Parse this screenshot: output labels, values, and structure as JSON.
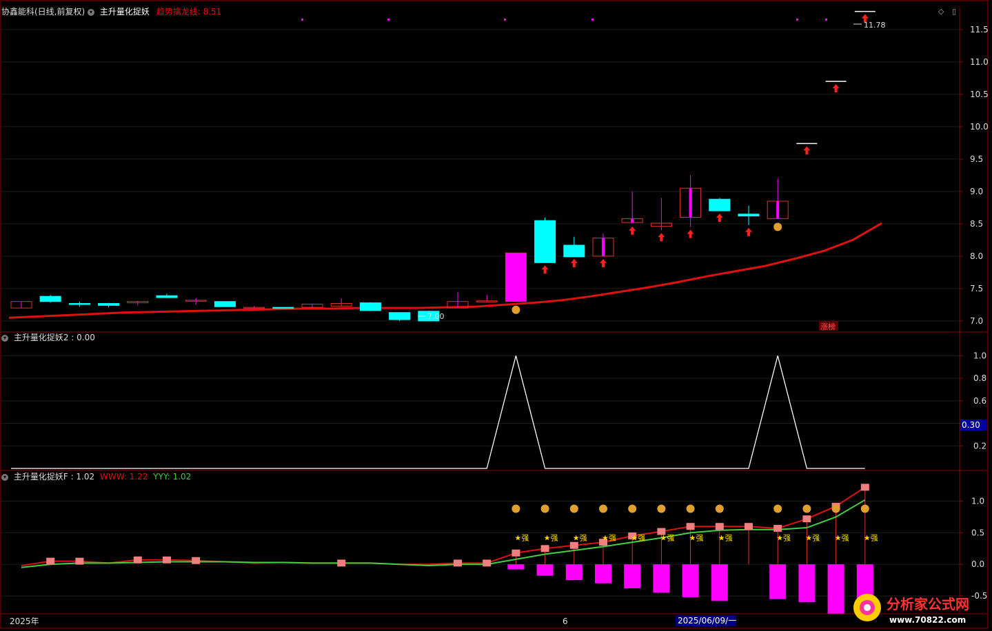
{
  "colors": {
    "background": "#000000",
    "up": "#ff00ff",
    "down": "#00ffff",
    "ma": "#e01010",
    "grid": "#1c1c1c",
    "axis_text": "#dddddd",
    "green_line": "#40d040",
    "salmon": "#f08080"
  },
  "panel1": {
    "stock_title": "协鑫能科(日线,前复权)",
    "indicator_name": "主升量化捉妖",
    "ma_label": "趋势擒龙线:",
    "ma_value": "8.51",
    "high_label": "11.78",
    "low_label": "7.00",
    "zt_badge": "涨榜",
    "axis_ticks": [
      "11.5",
      "11.0",
      "10.5",
      "10.0",
      "9.5",
      "9.0",
      "8.5",
      "8.0",
      "7.5",
      "7.0"
    ]
  },
  "panel2": {
    "title": "主升量化捉妖2",
    "value": "0.00",
    "axis_ticks": [
      "1.0",
      "0.8",
      "0.6",
      "0.4",
      "0.2"
    ],
    "cursor_value": "0.30"
  },
  "panel3": {
    "title": "主升量化捉妖F",
    "value": "1.02",
    "www_label": "WWW:",
    "www_value": "1.22",
    "yyy_label": "YYY:",
    "yyy_value": "1.02",
    "axis_ticks": [
      "1.0",
      "0.5",
      "0.0",
      "-0.5"
    ],
    "strong_label": "★强"
  },
  "date_axis": {
    "year_label": "2025年",
    "month_label": "6",
    "cursor_date": "2025/06/09/一"
  },
  "watermark": {
    "text": "分析家公式网",
    "url": "www.70822.com"
  },
  "chart_data": [
    {
      "type": "candlestick",
      "title": "协鑫能科(日线,前复权)",
      "ylim": [
        6.85,
        11.85
      ],
      "candles": [
        {
          "o": 7.2,
          "h": 7.3,
          "l": 7.2,
          "c": 7.3
        },
        {
          "o": 7.38,
          "h": 7.4,
          "l": 7.28,
          "c": 7.3
        },
        {
          "o": 7.27,
          "h": 7.3,
          "l": 7.22,
          "c": 7.26
        },
        {
          "o": 7.27,
          "h": 7.28,
          "l": 7.21,
          "c": 7.24
        },
        {
          "o": 7.28,
          "h": 7.31,
          "l": 7.24,
          "c": 7.3
        },
        {
          "o": 7.39,
          "h": 7.42,
          "l": 7.36,
          "c": 7.36
        },
        {
          "o": 7.32,
          "h": 7.35,
          "l": 7.25,
          "c": 7.32
        },
        {
          "o": 7.3,
          "h": 7.3,
          "l": 7.22,
          "c": 7.22
        },
        {
          "o": 7.21,
          "h": 7.23,
          "l": 7.2,
          "c": 7.21
        },
        {
          "o": 7.21,
          "h": 7.21,
          "l": 7.2,
          "c": 7.2
        },
        {
          "o": 7.21,
          "h": 7.26,
          "l": 7.2,
          "c": 7.26
        },
        {
          "o": 7.23,
          "h": 7.35,
          "l": 7.23,
          "c": 7.27
        },
        {
          "o": 7.28,
          "h": 7.29,
          "l": 7.15,
          "c": 7.16
        },
        {
          "o": 7.13,
          "h": 7.13,
          "l": 7.0,
          "c": 7.02
        },
        {
          "o": 7.15,
          "h": 7.16,
          "l": 7.0,
          "c": 7.0
        },
        {
          "o": 7.2,
          "h": 7.45,
          "l": 7.2,
          "c": 7.3
        },
        {
          "o": 7.31,
          "h": 7.4,
          "l": 7.3,
          "c": 7.31
        },
        {
          "o": 7.3,
          "h": 8.05,
          "l": 7.3,
          "c": 8.05
        },
        {
          "o": 8.55,
          "h": 8.6,
          "l": 7.9,
          "c": 7.9
        },
        {
          "o": 8.17,
          "h": 8.3,
          "l": 8.0,
          "c": 7.99
        },
        {
          "o": 8.0,
          "h": 8.35,
          "l": 8.0,
          "c": 8.28
        },
        {
          "o": 8.52,
          "h": 9.0,
          "l": 8.5,
          "c": 8.58
        },
        {
          "o": 8.46,
          "h": 8.9,
          "l": 8.4,
          "c": 8.51
        },
        {
          "o": 8.6,
          "h": 9.25,
          "l": 8.45,
          "c": 9.05
        },
        {
          "o": 8.88,
          "h": 8.9,
          "l": 8.7,
          "c": 8.7
        },
        {
          "o": 8.65,
          "h": 8.78,
          "l": 8.48,
          "c": 8.62
        },
        {
          "o": 8.58,
          "h": 9.2,
          "l": 8.58,
          "c": 8.85
        },
        {
          "o": 9.74,
          "h": 9.74,
          "l": 9.74,
          "c": 9.74
        },
        {
          "o": 10.7,
          "h": 10.7,
          "l": 10.7,
          "c": 10.7
        },
        {
          "o": 11.78,
          "h": 11.78,
          "l": 11.78,
          "c": 11.78
        }
      ],
      "ma_line": [
        7.05,
        7.07,
        7.09,
        7.11,
        7.13,
        7.14,
        7.15,
        7.16,
        7.17,
        7.18,
        7.19,
        7.19,
        7.2,
        7.2,
        7.2,
        7.21,
        7.22,
        7.25,
        7.28,
        7.32,
        7.38,
        7.45,
        7.52,
        7.6,
        7.69,
        7.77,
        7.85,
        7.96,
        8.08,
        8.25,
        8.51
      ]
    },
    {
      "type": "line",
      "title": "主升量化捉妖2",
      "ylim": [
        0,
        1.1
      ],
      "values": [
        0,
        0,
        0,
        0,
        0,
        0,
        0,
        0,
        0,
        0,
        0,
        0,
        0,
        0,
        0,
        0,
        0,
        1,
        0,
        0,
        0,
        0,
        0,
        0,
        0,
        0,
        1,
        0,
        0,
        0
      ]
    },
    {
      "type": "bar",
      "title": "主升量化捉妖F",
      "ylim": [
        -0.75,
        1.3
      ],
      "series": [
        {
          "name": "WWW",
          "values": [
            -0.02,
            0.05,
            0.05,
            0.02,
            0.07,
            0.07,
            0.06,
            0.04,
            0.02,
            0.03,
            0.02,
            0.02,
            0.02,
            0.0,
            0.0,
            0.02,
            0.02,
            0.18,
            0.25,
            0.3,
            0.35,
            0.45,
            0.52,
            0.6,
            0.6,
            0.6,
            0.57,
            0.72,
            0.92,
            1.22
          ]
        },
        {
          "name": "YYY",
          "values": [
            -0.05,
            0.0,
            0.02,
            0.02,
            0.03,
            0.04,
            0.04,
            0.04,
            0.03,
            0.03,
            0.02,
            0.02,
            0.02,
            0.0,
            -0.02,
            0.0,
            0.0,
            0.08,
            0.16,
            0.22,
            0.28,
            0.35,
            0.42,
            0.5,
            0.54,
            0.55,
            0.55,
            0.58,
            0.75,
            1.02
          ]
        }
      ],
      "neg_bars": [
        0,
        0,
        0,
        0,
        0,
        0,
        0,
        0,
        0,
        0,
        0,
        0,
        0,
        0,
        0,
        0,
        0,
        -0.08,
        -0.18,
        -0.25,
        -0.3,
        -0.38,
        -0.45,
        -0.52,
        -0.58,
        0,
        -0.55,
        -0.6,
        -0.78,
        -0.65
      ]
    }
  ]
}
